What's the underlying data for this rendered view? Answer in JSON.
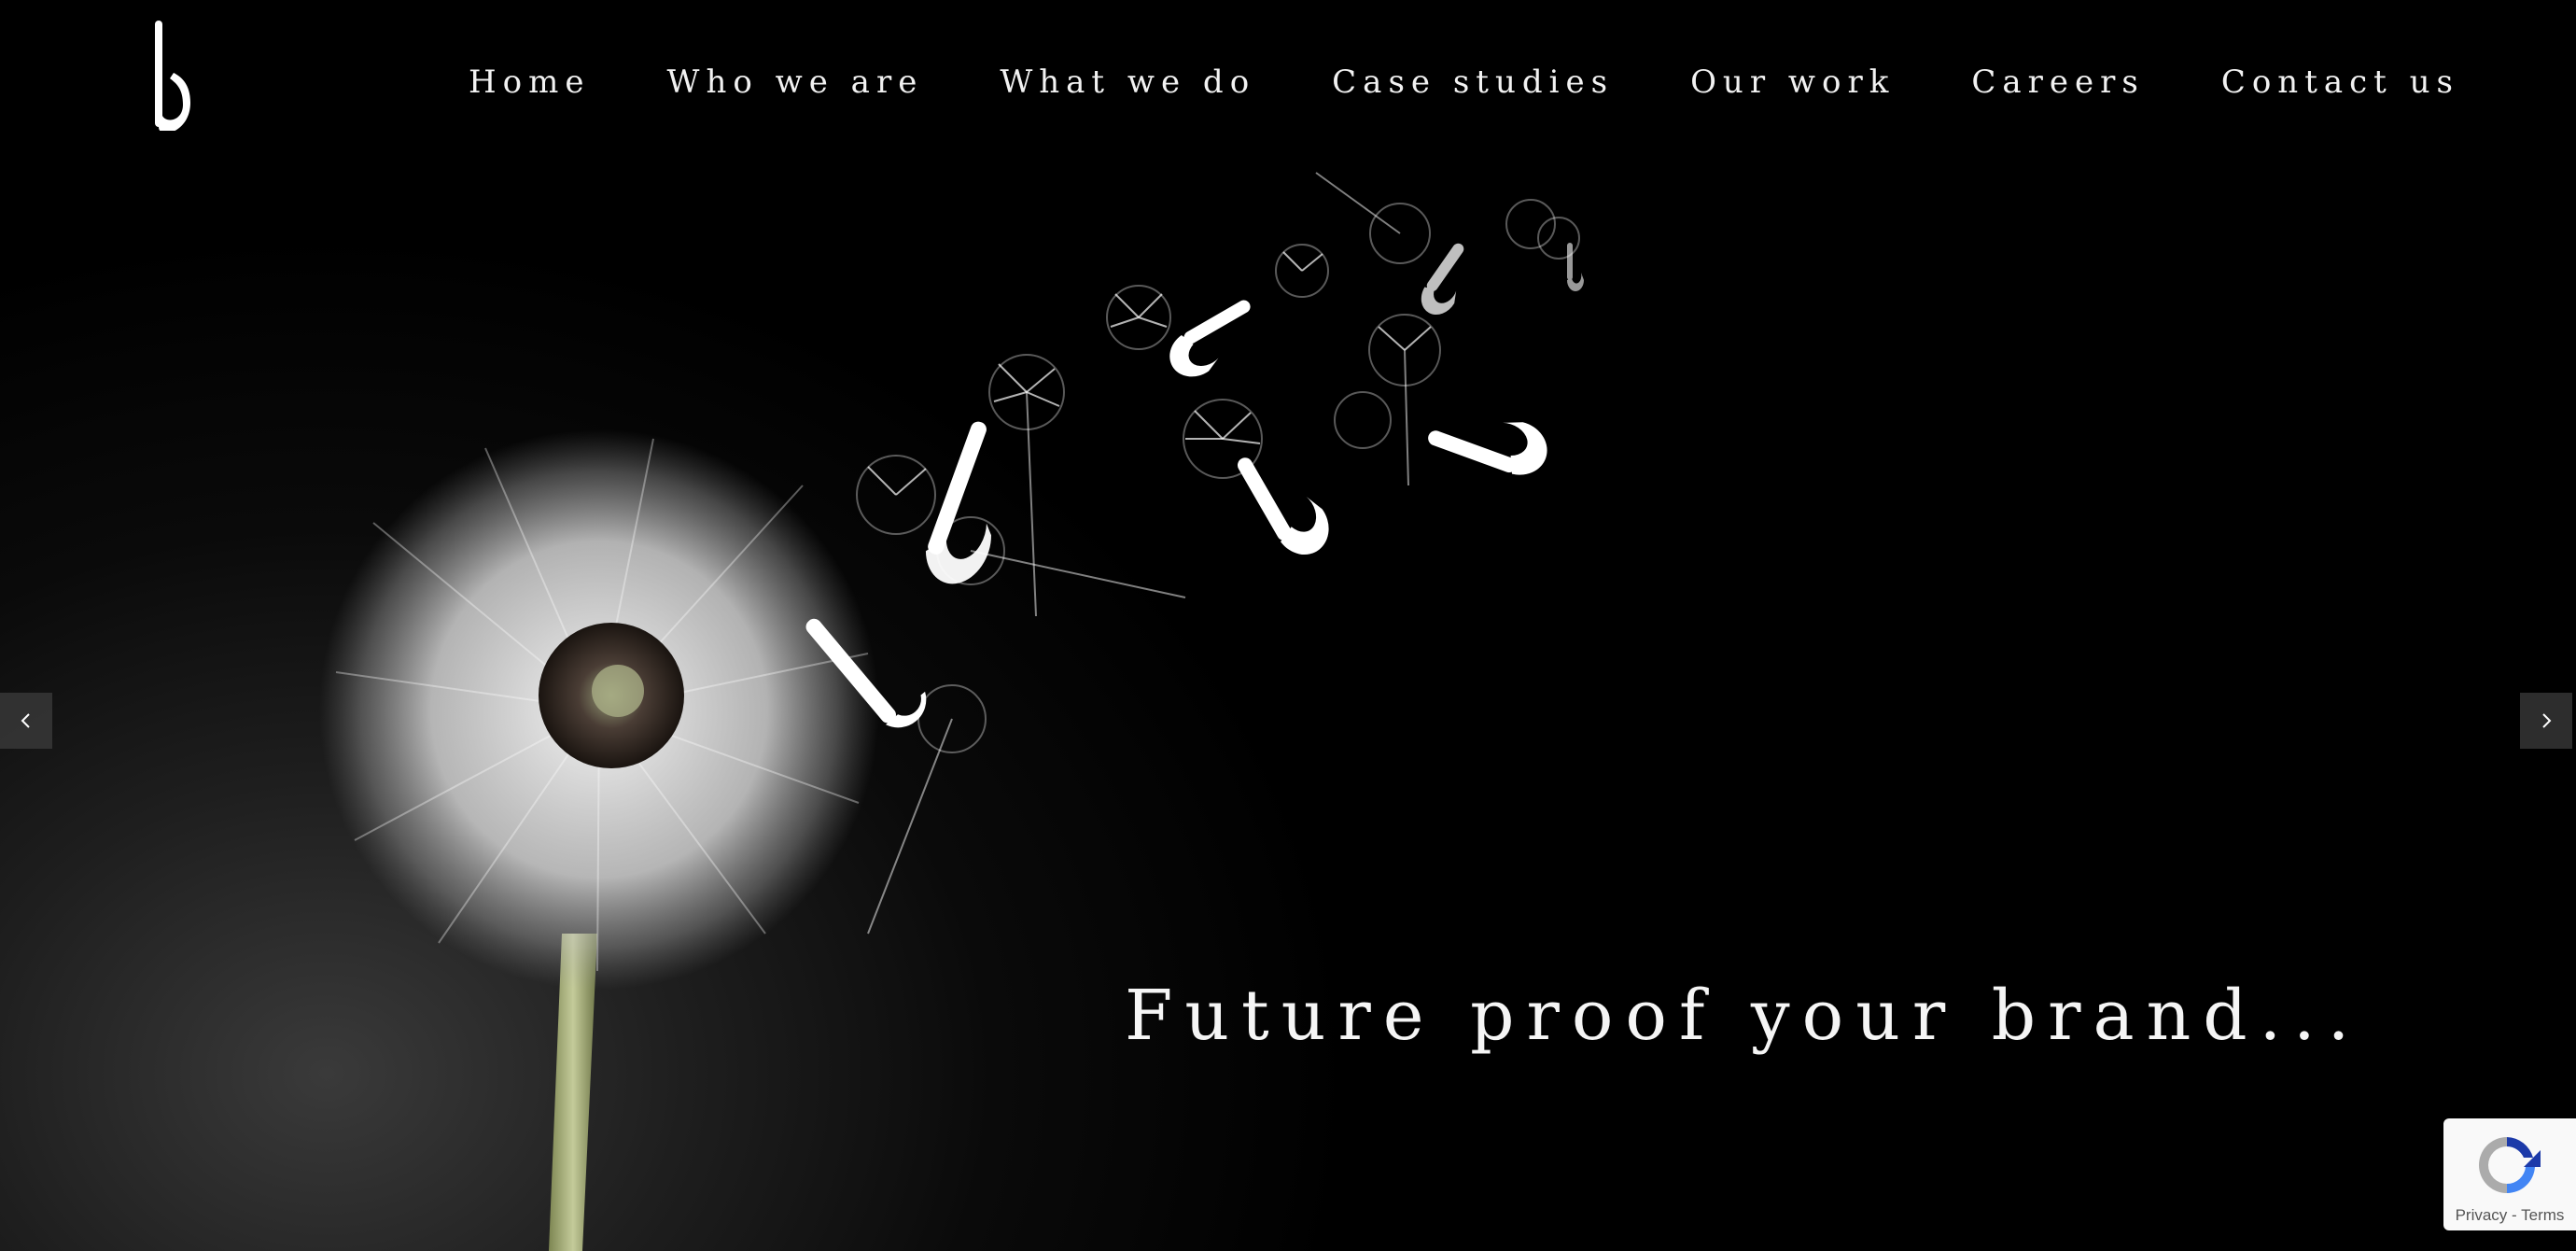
{
  "brand": {
    "logo_icon": "brand-b-logo-icon"
  },
  "nav": {
    "items": [
      {
        "label": "Home"
      },
      {
        "label": "Who we are"
      },
      {
        "label": "What we do"
      },
      {
        "label": "Case studies"
      },
      {
        "label": "Our work"
      },
      {
        "label": "Careers"
      },
      {
        "label": "Contact us"
      }
    ]
  },
  "slider": {
    "prev_icon": "chevron-left-icon",
    "next_icon": "chevron-right-icon"
  },
  "hero": {
    "tagline": "Future proof your brand...",
    "image": "dandelion-seeds-icon"
  },
  "recaptcha": {
    "privacy": "Privacy",
    "separator": " - ",
    "terms": "Terms"
  },
  "colors": {
    "background": "#000000",
    "text": "#f2f2f2",
    "stem": "#b7bf8a"
  }
}
